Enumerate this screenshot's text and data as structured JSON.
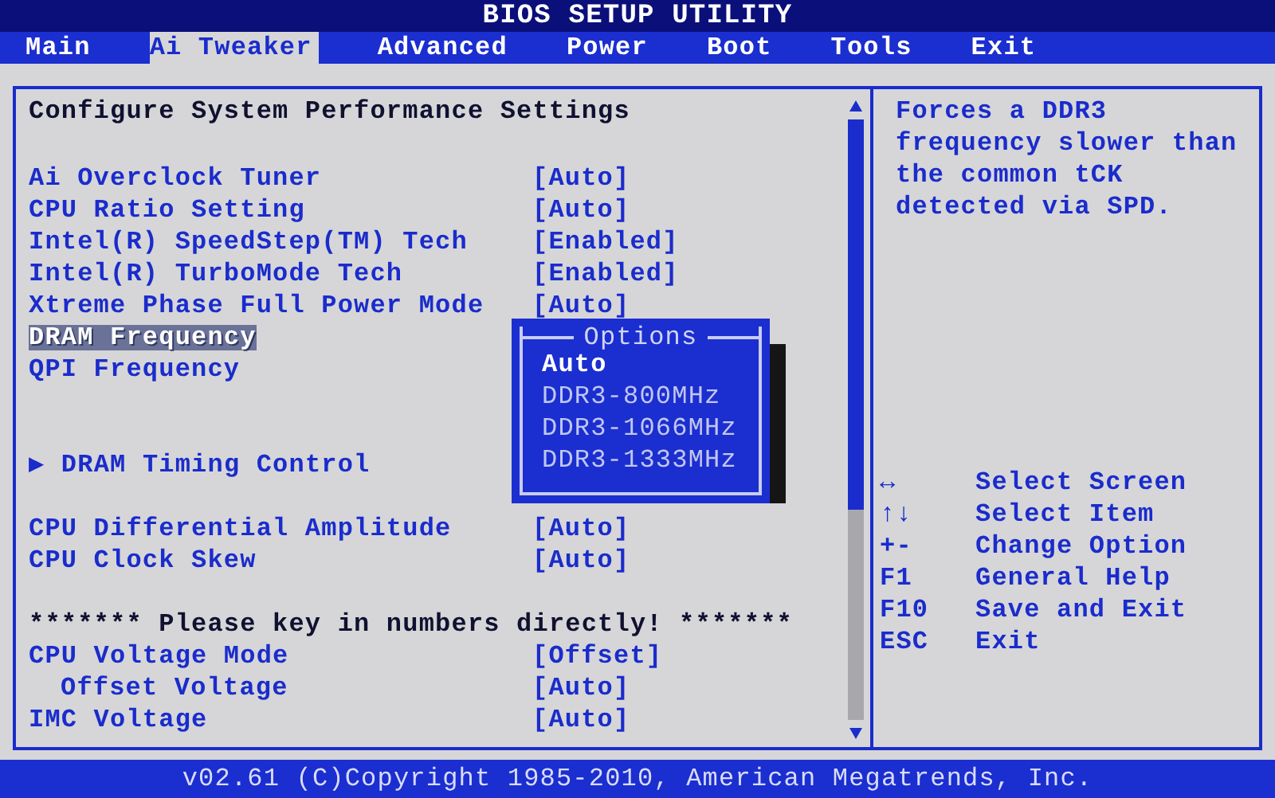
{
  "window": {
    "title": "BIOS SETUP UTILITY"
  },
  "tabs": [
    {
      "label": "Main",
      "selected": false
    },
    {
      "label": "Ai Tweaker",
      "selected": true
    },
    {
      "label": "Advanced",
      "selected": false
    },
    {
      "label": "Power",
      "selected": false
    },
    {
      "label": "Boot",
      "selected": false
    },
    {
      "label": "Tools",
      "selected": false
    },
    {
      "label": "Exit",
      "selected": false
    }
  ],
  "settings": {
    "heading": "Configure System Performance Settings",
    "sections": [
      {
        "items": [
          {
            "kind": "setting",
            "label": "Ai Overclock Tuner",
            "value": "[Auto]",
            "selected": false
          },
          {
            "kind": "setting",
            "label": "CPU Ratio Setting",
            "value": "[Auto]",
            "selected": false
          },
          {
            "kind": "setting",
            "label": "Intel(R) SpeedStep(TM) Tech",
            "value": "[Enabled]",
            "selected": false
          },
          {
            "kind": "setting",
            "label": "Intel(R) TurboMode Tech",
            "value": "[Enabled]",
            "selected": false
          },
          {
            "kind": "setting",
            "label": "Xtreme Phase Full Power Mode",
            "value": "[Auto]",
            "selected": false
          },
          {
            "kind": "setting",
            "label": "DRAM Frequency",
            "selected": true
          },
          {
            "kind": "setting",
            "label": "QPI Frequency",
            "selected": false
          }
        ]
      },
      {
        "items": [
          {
            "kind": "submenu",
            "label": "▶ DRAM Timing Control",
            "selected": false
          }
        ]
      },
      {
        "items": [
          {
            "kind": "setting",
            "label": "CPU Differential Amplitude",
            "value": "[Auto]",
            "selected": false
          },
          {
            "kind": "setting",
            "label": "CPU Clock Skew",
            "value": "[Auto]",
            "selected": false
          }
        ]
      },
      {
        "items": [
          {
            "kind": "note",
            "label": "******* Please key in numbers directly! *******"
          },
          {
            "kind": "setting",
            "label": "CPU Voltage Mode",
            "value": "[Offset]",
            "selected": false
          },
          {
            "kind": "subsetting",
            "label": "Offset Voltage",
            "value": "[Auto]",
            "selected": false
          },
          {
            "kind": "setting",
            "label": "IMC Voltage",
            "value": "[Auto]",
            "selected": false
          }
        ]
      }
    ]
  },
  "options_popup": {
    "title": "Options",
    "options": [
      {
        "label": "Auto",
        "selected": true
      },
      {
        "label": "DDR3-800MHz",
        "selected": false
      },
      {
        "label": "DDR3-1066MHz",
        "selected": false
      },
      {
        "label": "DDR3-1333MHz",
        "selected": false
      }
    ]
  },
  "help": {
    "text": "Forces a DDR3 frequency slower than the common tCK detected via SPD.",
    "keys": [
      {
        "key": "↔",
        "action": "Select Screen"
      },
      {
        "key": "↑↓",
        "action": "Select Item"
      },
      {
        "key": "+-",
        "action": "Change Option"
      },
      {
        "key": "F1",
        "action": "General Help"
      },
      {
        "key": "F10",
        "action": "Save and Exit"
      },
      {
        "key": "ESC",
        "action": "Exit"
      }
    ]
  },
  "status_bar": {
    "text": "v02.61 (C)Copyright 1985-2010, American Megatrends, Inc."
  }
}
